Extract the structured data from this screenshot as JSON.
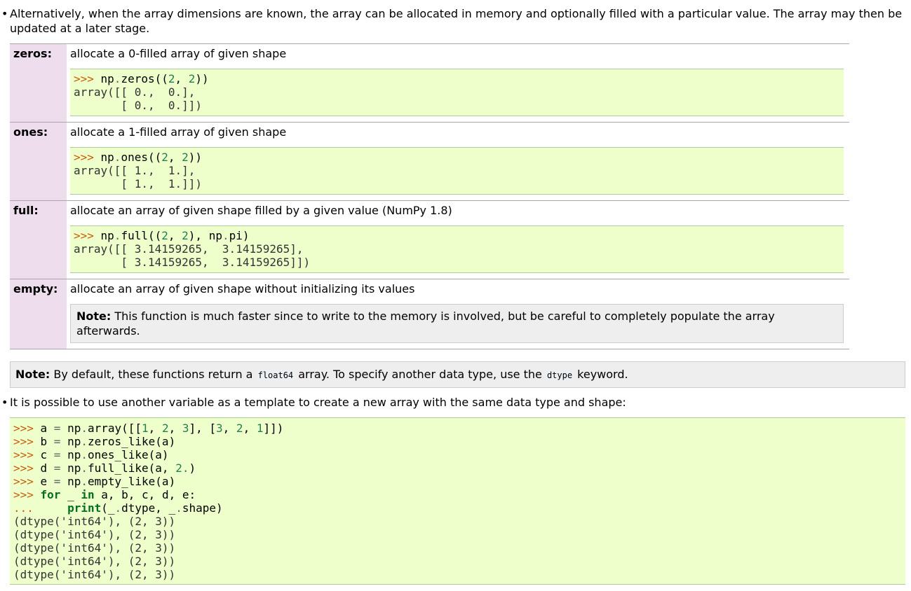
{
  "bullet_glyph": "•",
  "intro": "Alternatively, when the array dimensions are known, the array can be allocated in memory and optionally filled with a particular value. The array may then be updated at a later stage.",
  "fields": [
    {
      "name": "zeros:",
      "description": "allocate a 0-filled array of given shape",
      "code": {
        "prompt": ">>> ",
        "call": [
          "np",
          ".",
          "zeros",
          "((",
          "2",
          ", ",
          "2",
          "))"
        ],
        "output": [
          "array([[ 0.,  0.],",
          "       [ 0.,  0.]])"
        ]
      }
    },
    {
      "name": "ones:",
      "description": "allocate a 1-filled array of given shape",
      "code": {
        "prompt": ">>> ",
        "call": [
          "np",
          ".",
          "ones",
          "((",
          "2",
          ", ",
          "2",
          "))"
        ],
        "output": [
          "array([[ 1.,  1.],",
          "       [ 1.,  1.]])"
        ]
      }
    },
    {
      "name": "full:",
      "description": "allocate an array of given shape filled by a given value (NumPy 1.8)",
      "code": {
        "prompt": ">>> ",
        "call": [
          "np",
          ".",
          "full",
          "((",
          "2",
          ", ",
          "2",
          "), ",
          "np",
          ".",
          "pi",
          ")"
        ],
        "output": [
          "array([[ 3.14159265,  3.14159265],",
          "       [ 3.14159265,  3.14159265]])"
        ]
      }
    },
    {
      "name": "empty:",
      "description": "allocate an array of given shape without initializing its values",
      "note_label": "Note:",
      "note_text": " This function is much faster since to write to the memory is involved, but be careful to completely populate the array afterwards."
    }
  ],
  "note_default": {
    "label": "Note:",
    "before": " By default, these functions return a ",
    "code1": "float64",
    "middle": " array. To specify another data type, use the ",
    "code2": "dtype",
    "after": " keyword."
  },
  "template_bullet": "It is possible to use another variable as a template to create a new array with the same data type and shape:",
  "template_code": {
    "line1": [
      ">>> ",
      "a ",
      "= ",
      "np",
      ".",
      "array([[",
      "1",
      ", ",
      "2",
      ", ",
      "3",
      "], [",
      "3",
      ", ",
      "2",
      ", ",
      "1",
      "]])"
    ],
    "line2": [
      ">>> ",
      "b ",
      "= ",
      "np",
      ".",
      "zeros_like(a)"
    ],
    "line3": [
      ">>> ",
      "c ",
      "= ",
      "np",
      ".",
      "ones_like(a)"
    ],
    "line4": [
      ">>> ",
      "d ",
      "= ",
      "np",
      ".",
      "full_like(a, ",
      "2.",
      ")"
    ],
    "line5": [
      ">>> ",
      "e ",
      "= ",
      "np",
      ".",
      "empty_like(a)"
    ],
    "line6": [
      ">>> ",
      "for",
      " _ ",
      "in",
      " a, b, c, d, e:"
    ],
    "line7": [
      "...     ",
      "print",
      "(_",
      ".",
      "dtype, _",
      ".",
      "shape)"
    ],
    "output": [
      "(dtype('int64'), (2, 3))",
      "(dtype('int64'), (2, 3))",
      "(dtype('int64'), (2, 3))",
      "(dtype('int64'), (2, 3))",
      "(dtype('int64'), (2, 3))"
    ]
  }
}
